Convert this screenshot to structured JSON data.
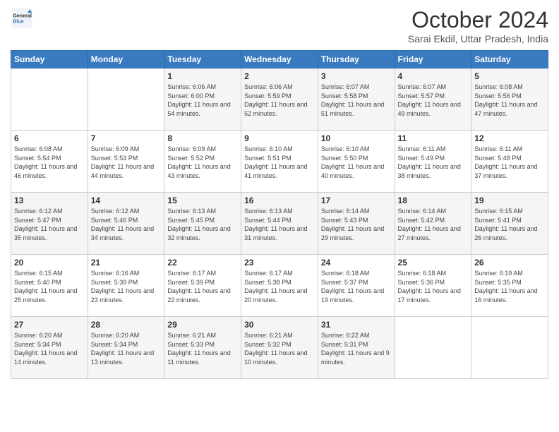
{
  "header": {
    "logo_line1": "General",
    "logo_line2": "Blue",
    "month": "October 2024",
    "location": "Sarai Ekdil, Uttar Pradesh, India"
  },
  "days_of_week": [
    "Sunday",
    "Monday",
    "Tuesday",
    "Wednesday",
    "Thursday",
    "Friday",
    "Saturday"
  ],
  "weeks": [
    [
      {
        "day": "",
        "sunrise": "",
        "sunset": "",
        "daylight": ""
      },
      {
        "day": "",
        "sunrise": "",
        "sunset": "",
        "daylight": ""
      },
      {
        "day": "1",
        "sunrise": "Sunrise: 6:06 AM",
        "sunset": "Sunset: 6:00 PM",
        "daylight": "Daylight: 11 hours and 54 minutes."
      },
      {
        "day": "2",
        "sunrise": "Sunrise: 6:06 AM",
        "sunset": "Sunset: 5:59 PM",
        "daylight": "Daylight: 11 hours and 52 minutes."
      },
      {
        "day": "3",
        "sunrise": "Sunrise: 6:07 AM",
        "sunset": "Sunset: 5:58 PM",
        "daylight": "Daylight: 11 hours and 51 minutes."
      },
      {
        "day": "4",
        "sunrise": "Sunrise: 6:07 AM",
        "sunset": "Sunset: 5:57 PM",
        "daylight": "Daylight: 11 hours and 49 minutes."
      },
      {
        "day": "5",
        "sunrise": "Sunrise: 6:08 AM",
        "sunset": "Sunset: 5:56 PM",
        "daylight": "Daylight: 11 hours and 47 minutes."
      }
    ],
    [
      {
        "day": "6",
        "sunrise": "Sunrise: 6:08 AM",
        "sunset": "Sunset: 5:54 PM",
        "daylight": "Daylight: 11 hours and 46 minutes."
      },
      {
        "day": "7",
        "sunrise": "Sunrise: 6:09 AM",
        "sunset": "Sunset: 5:53 PM",
        "daylight": "Daylight: 11 hours and 44 minutes."
      },
      {
        "day": "8",
        "sunrise": "Sunrise: 6:09 AM",
        "sunset": "Sunset: 5:52 PM",
        "daylight": "Daylight: 11 hours and 43 minutes."
      },
      {
        "day": "9",
        "sunrise": "Sunrise: 6:10 AM",
        "sunset": "Sunset: 5:51 PM",
        "daylight": "Daylight: 11 hours and 41 minutes."
      },
      {
        "day": "10",
        "sunrise": "Sunrise: 6:10 AM",
        "sunset": "Sunset: 5:50 PM",
        "daylight": "Daylight: 11 hours and 40 minutes."
      },
      {
        "day": "11",
        "sunrise": "Sunrise: 6:11 AM",
        "sunset": "Sunset: 5:49 PM",
        "daylight": "Daylight: 11 hours and 38 minutes."
      },
      {
        "day": "12",
        "sunrise": "Sunrise: 6:11 AM",
        "sunset": "Sunset: 5:48 PM",
        "daylight": "Daylight: 11 hours and 37 minutes."
      }
    ],
    [
      {
        "day": "13",
        "sunrise": "Sunrise: 6:12 AM",
        "sunset": "Sunset: 5:47 PM",
        "daylight": "Daylight: 11 hours and 35 minutes."
      },
      {
        "day": "14",
        "sunrise": "Sunrise: 6:12 AM",
        "sunset": "Sunset: 5:46 PM",
        "daylight": "Daylight: 11 hours and 34 minutes."
      },
      {
        "day": "15",
        "sunrise": "Sunrise: 6:13 AM",
        "sunset": "Sunset: 5:45 PM",
        "daylight": "Daylight: 11 hours and 32 minutes."
      },
      {
        "day": "16",
        "sunrise": "Sunrise: 6:13 AM",
        "sunset": "Sunset: 5:44 PM",
        "daylight": "Daylight: 11 hours and 31 minutes."
      },
      {
        "day": "17",
        "sunrise": "Sunrise: 6:14 AM",
        "sunset": "Sunset: 5:43 PM",
        "daylight": "Daylight: 11 hours and 29 minutes."
      },
      {
        "day": "18",
        "sunrise": "Sunrise: 6:14 AM",
        "sunset": "Sunset: 5:42 PM",
        "daylight": "Daylight: 11 hours and 27 minutes."
      },
      {
        "day": "19",
        "sunrise": "Sunrise: 6:15 AM",
        "sunset": "Sunset: 5:41 PM",
        "daylight": "Daylight: 11 hours and 26 minutes."
      }
    ],
    [
      {
        "day": "20",
        "sunrise": "Sunrise: 6:15 AM",
        "sunset": "Sunset: 5:40 PM",
        "daylight": "Daylight: 11 hours and 25 minutes."
      },
      {
        "day": "21",
        "sunrise": "Sunrise: 6:16 AM",
        "sunset": "Sunset: 5:39 PM",
        "daylight": "Daylight: 11 hours and 23 minutes."
      },
      {
        "day": "22",
        "sunrise": "Sunrise: 6:17 AM",
        "sunset": "Sunset: 5:39 PM",
        "daylight": "Daylight: 11 hours and 22 minutes."
      },
      {
        "day": "23",
        "sunrise": "Sunrise: 6:17 AM",
        "sunset": "Sunset: 5:38 PM",
        "daylight": "Daylight: 11 hours and 20 minutes."
      },
      {
        "day": "24",
        "sunrise": "Sunrise: 6:18 AM",
        "sunset": "Sunset: 5:37 PM",
        "daylight": "Daylight: 11 hours and 19 minutes."
      },
      {
        "day": "25",
        "sunrise": "Sunrise: 6:18 AM",
        "sunset": "Sunset: 5:36 PM",
        "daylight": "Daylight: 11 hours and 17 minutes."
      },
      {
        "day": "26",
        "sunrise": "Sunrise: 6:19 AM",
        "sunset": "Sunset: 5:35 PM",
        "daylight": "Daylight: 11 hours and 16 minutes."
      }
    ],
    [
      {
        "day": "27",
        "sunrise": "Sunrise: 6:20 AM",
        "sunset": "Sunset: 5:34 PM",
        "daylight": "Daylight: 11 hours and 14 minutes."
      },
      {
        "day": "28",
        "sunrise": "Sunrise: 6:20 AM",
        "sunset": "Sunset: 5:34 PM",
        "daylight": "Daylight: 11 hours and 13 minutes."
      },
      {
        "day": "29",
        "sunrise": "Sunrise: 6:21 AM",
        "sunset": "Sunset: 5:33 PM",
        "daylight": "Daylight: 11 hours and 11 minutes."
      },
      {
        "day": "30",
        "sunrise": "Sunrise: 6:21 AM",
        "sunset": "Sunset: 5:32 PM",
        "daylight": "Daylight: 11 hours and 10 minutes."
      },
      {
        "day": "31",
        "sunrise": "Sunrise: 6:22 AM",
        "sunset": "Sunset: 5:31 PM",
        "daylight": "Daylight: 11 hours and 9 minutes."
      },
      {
        "day": "",
        "sunrise": "",
        "sunset": "",
        "daylight": ""
      },
      {
        "day": "",
        "sunrise": "",
        "sunset": "",
        "daylight": ""
      }
    ]
  ]
}
